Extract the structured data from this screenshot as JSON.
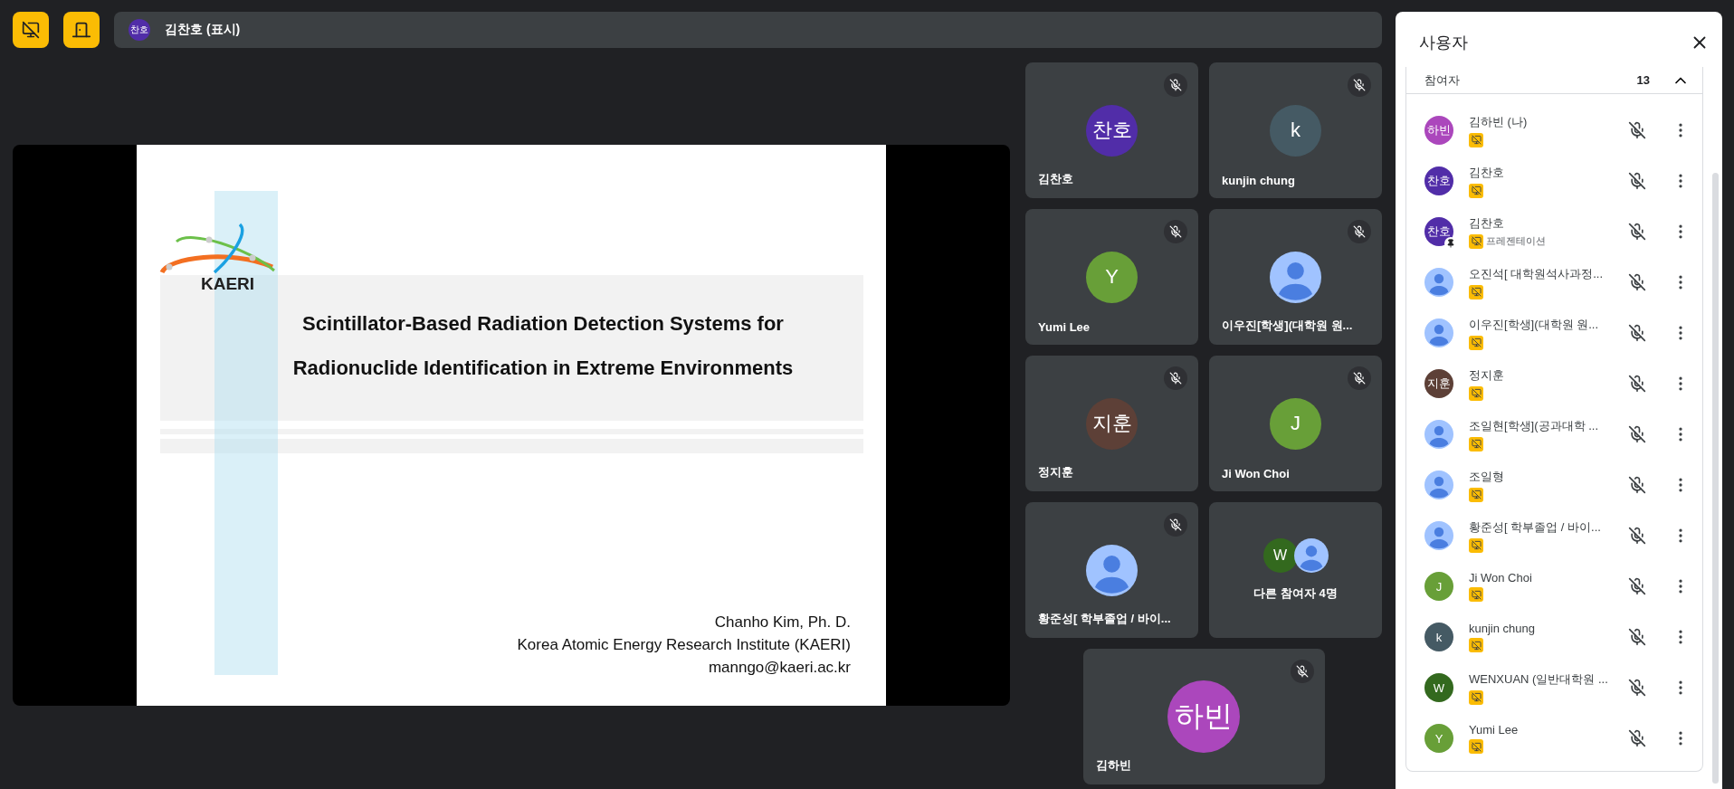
{
  "toolbar": {
    "presenter": {
      "avatar": {
        "kind": "initials",
        "text": "찬호",
        "color": "#512da8"
      },
      "label": "김찬호 (표시)"
    }
  },
  "slide": {
    "logo_text": "KAERI",
    "title_lines": [
      "Scintillator-Based Radiation Detection Systems for",
      "Radionuclide Identification in Extreme Environments"
    ],
    "footer_lines": [
      "Chanho Kim, Ph. D.",
      "Korea Atomic Energy Research Institute (KAERI)",
      "manngo@kaeri.ac.kr"
    ]
  },
  "tiles": [
    {
      "kind": "person",
      "name": "김찬호",
      "muted": true,
      "avatar": {
        "kind": "initials",
        "text": "찬호",
        "color": "#512da8"
      }
    },
    {
      "kind": "person",
      "name": "kunjin chung",
      "muted": true,
      "avatar": {
        "kind": "initials",
        "text": "k",
        "color": "#455a64"
      }
    },
    {
      "kind": "person",
      "name": "Yumi Lee",
      "muted": true,
      "avatar": {
        "kind": "initials",
        "text": "Y",
        "color": "#689f38"
      }
    },
    {
      "kind": "person",
      "name": "이우진[학생](대학원 원...",
      "muted": true,
      "avatar": {
        "kind": "silhouette"
      }
    },
    {
      "kind": "person",
      "name": "정지훈",
      "muted": true,
      "avatar": {
        "kind": "initials",
        "text": "지훈",
        "color": "#5d4037"
      }
    },
    {
      "kind": "person",
      "name": "Ji Won Choi",
      "muted": true,
      "avatar": {
        "kind": "initials",
        "text": "J",
        "color": "#689f38"
      }
    },
    {
      "kind": "person",
      "name": "황준성[ 학부졸업 / 바이...",
      "muted": true,
      "avatar": {
        "kind": "silhouette"
      }
    },
    {
      "kind": "group",
      "name": "다른 참여자 4명",
      "avatars": [
        {
          "kind": "initials",
          "text": "W",
          "color": "#33691e"
        },
        {
          "kind": "silhouette"
        }
      ]
    },
    {
      "kind": "self",
      "name": "김하빈",
      "muted": true,
      "avatar": {
        "kind": "initials",
        "text": "하빈",
        "color": "#ab47bc"
      }
    }
  ],
  "panel": {
    "title": "사용자",
    "section": {
      "label": "참여자",
      "count": "13",
      "expanded": true
    },
    "participants": [
      {
        "name": "김하빈 (나)",
        "pinned": false,
        "avatar": {
          "kind": "initials",
          "text": "하빈",
          "color": "#ab47bc"
        }
      },
      {
        "name": "김찬호",
        "pinned": false,
        "avatar": {
          "kind": "initials",
          "text": "찬호",
          "color": "#512da8"
        }
      },
      {
        "name": "김찬호",
        "subtitle": "프레젠테이션",
        "pinned": true,
        "avatar": {
          "kind": "initials",
          "text": "찬호",
          "color": "#512da8"
        }
      },
      {
        "name": "오진석[ 대학원석사과정...",
        "pinned": false,
        "avatar": {
          "kind": "silhouette"
        }
      },
      {
        "name": "이우진[학생](대학원 원...",
        "pinned": false,
        "avatar": {
          "kind": "silhouette"
        }
      },
      {
        "name": "정지훈",
        "pinned": false,
        "avatar": {
          "kind": "initials",
          "text": "지훈",
          "color": "#5d4037"
        }
      },
      {
        "name": "조일현[학생](공과대학 ...",
        "pinned": false,
        "avatar": {
          "kind": "silhouette"
        }
      },
      {
        "name": "조일형",
        "pinned": false,
        "avatar": {
          "kind": "silhouette"
        }
      },
      {
        "name": "황준성[ 학부졸업 / 바이...",
        "pinned": false,
        "avatar": {
          "kind": "silhouette"
        }
      },
      {
        "name": "Ji Won Choi",
        "pinned": false,
        "avatar": {
          "kind": "initials",
          "text": "J",
          "color": "#689f38"
        }
      },
      {
        "name": "kunjin chung",
        "pinned": false,
        "avatar": {
          "kind": "initials",
          "text": "k",
          "color": "#455a64"
        }
      },
      {
        "name": "WENXUAN (일반대학원 ...",
        "pinned": false,
        "avatar": {
          "kind": "initials",
          "text": "W",
          "color": "#33691e"
        }
      },
      {
        "name": "Yumi Lee",
        "pinned": false,
        "avatar": {
          "kind": "initials",
          "text": "Y",
          "color": "#689f38"
        }
      }
    ]
  }
}
